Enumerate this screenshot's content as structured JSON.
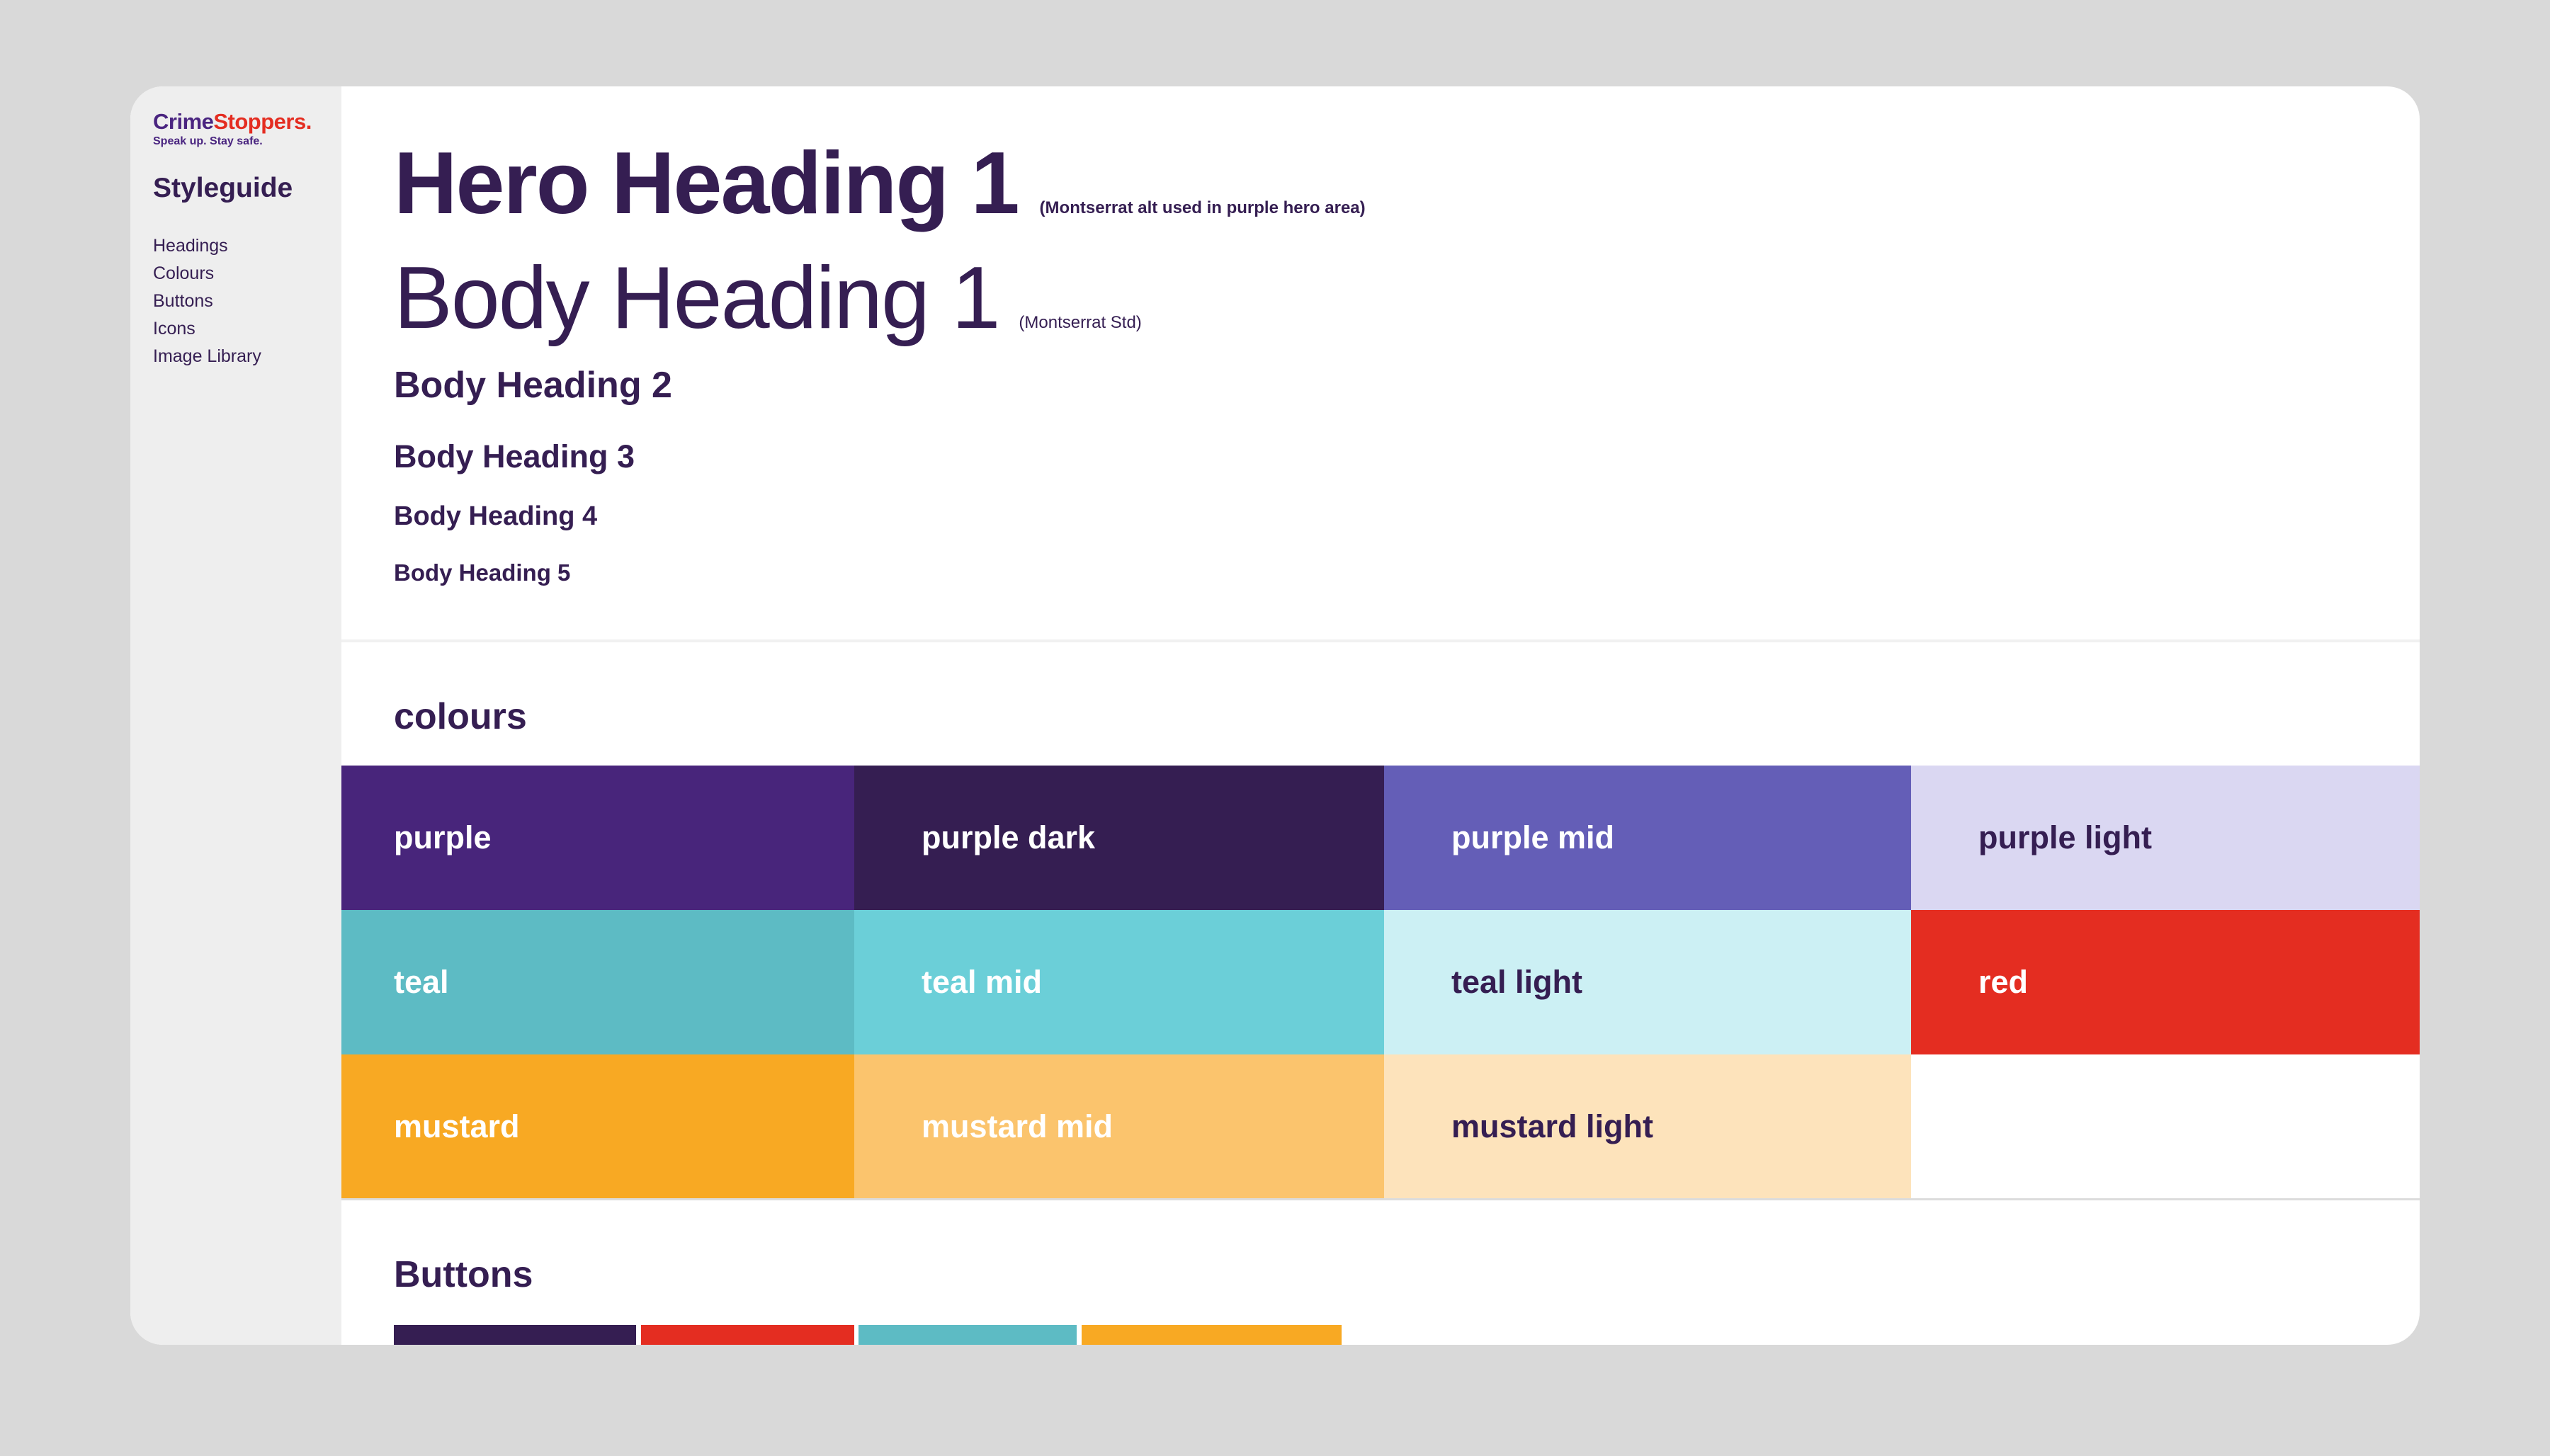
{
  "sidebar": {
    "logo": {
      "name_part1": "Crime",
      "name_part2": "Stoppers.",
      "tagline": "Speak up. Stay safe."
    },
    "title": "Styleguide",
    "nav": [
      {
        "label": "Headings"
      },
      {
        "label": "Colours"
      },
      {
        "label": "Buttons"
      },
      {
        "label": "Icons"
      },
      {
        "label": "Image Library"
      }
    ]
  },
  "headings": {
    "hero": {
      "text": "Hero Heading 1",
      "note": "(Montserrat alt used in purple hero area)"
    },
    "body1": {
      "text": "Body Heading 1",
      "note": "(Montserrat Std)"
    },
    "body2": "Body Heading 2",
    "body3": "Body Heading 3",
    "body4": "Body Heading 4",
    "body5": "Body Heading 5"
  },
  "colours": {
    "title": "colours",
    "swatches": [
      {
        "label": "purple",
        "color": "#48257b",
        "text_color": "#ffffff"
      },
      {
        "label": "purple dark",
        "color": "#351e52",
        "text_color": "#ffffff"
      },
      {
        "label": "purple mid",
        "color": "#645eb7",
        "text_color": "#ffffff"
      },
      {
        "label": "purple light",
        "color": "#dad7f2",
        "text_color": "#351e52"
      },
      {
        "label": "teal",
        "color": "#5dbbc4",
        "text_color": "#ffffff"
      },
      {
        "label": "teal mid",
        "color": "#6bcfd8",
        "text_color": "#ffffff"
      },
      {
        "label": "teal light",
        "color": "#ccf0f4",
        "text_color": "#351e52"
      },
      {
        "label": "red",
        "color": "#e42d21",
        "text_color": "#ffffff"
      },
      {
        "label": "mustard",
        "color": "#f8a923",
        "text_color": "#ffffff"
      },
      {
        "label": "mustard mid",
        "color": "#fbc46d",
        "text_color": "#ffffff"
      },
      {
        "label": "mustard light",
        "color": "#fde3bb",
        "text_color": "#351e52"
      }
    ]
  },
  "buttons": {
    "title": "Buttons",
    "items": [
      {
        "name": "purple-dark",
        "color": "#351e52"
      },
      {
        "name": "red",
        "color": "#e42d21"
      },
      {
        "name": "teal",
        "color": "#5dbbc4"
      },
      {
        "name": "mustard",
        "color": "#f8a923"
      }
    ]
  }
}
